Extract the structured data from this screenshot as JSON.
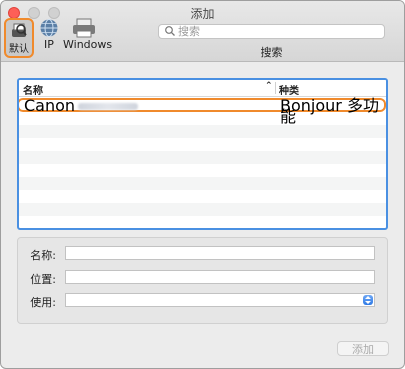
{
  "window": {
    "title": "添加"
  },
  "toolbar": {
    "default_label": "默认",
    "ip_label": "IP",
    "windows_label": "Windows",
    "search_placeholder": "搜索",
    "search_label": "搜索"
  },
  "list": {
    "columns": {
      "name": "名称",
      "kind": "种类"
    },
    "selected_row": {
      "name": "Canon",
      "kind": "Bonjour 多功能"
    }
  },
  "details": {
    "name_label": "名称:",
    "name_value": "",
    "location_label": "位置:",
    "location_value": "",
    "use_label": "使用:",
    "use_value": ""
  },
  "footer": {
    "add_button": "添加"
  },
  "colors": {
    "highlight": "#f08a2c",
    "focus": "#4a90e2",
    "close": "#fe5f57"
  }
}
